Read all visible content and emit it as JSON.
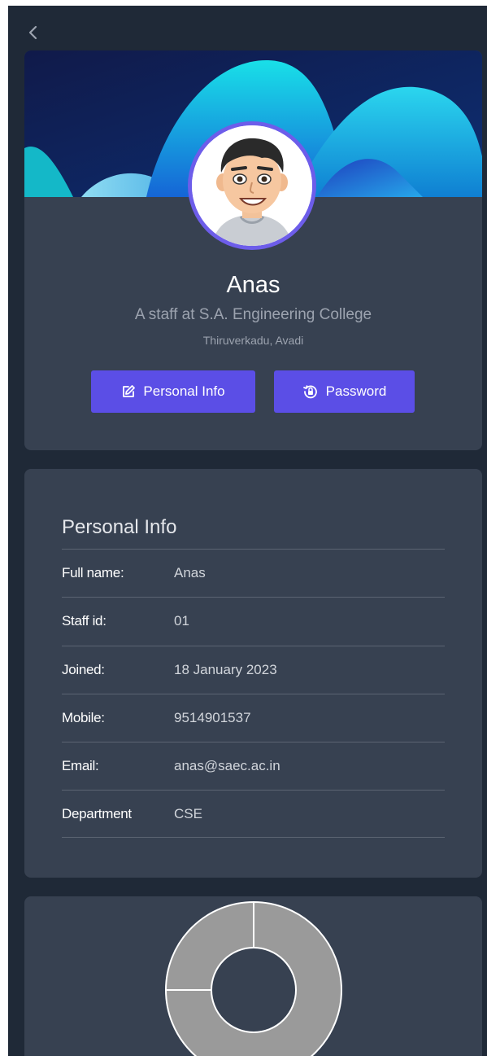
{
  "icons": {
    "back": "chevron-left-icon",
    "edit": "edit-icon",
    "password": "lock-reset-icon"
  },
  "colors": {
    "background": "#1f2937",
    "card": "#374151",
    "accent": "#5b4ee6",
    "avatar_ring": "#6d5dea"
  },
  "profile": {
    "name": "Anas",
    "role": "A staff at S.A. Engineering College",
    "location": "Thiruverkadu, Avadi",
    "buttons": {
      "personal_info": "Personal Info",
      "password": "Password"
    }
  },
  "personal_info": {
    "title": "Personal Info",
    "rows": [
      {
        "label": "Full name:",
        "value": "Anas"
      },
      {
        "label": "Staff id:",
        "value": "01"
      },
      {
        "label": "Joined:",
        "value": "18 January 2023"
      },
      {
        "label": "Mobile:",
        "value": "9514901537"
      },
      {
        "label": "Email:",
        "value": "anas@saec.ac.in"
      },
      {
        "label": "Department",
        "value": "CSE"
      }
    ]
  },
  "chart_data": {
    "type": "pie",
    "categories": [
      "",
      ""
    ],
    "values": [
      75,
      25
    ],
    "colors": [
      "#9a9a9a",
      "#9a9a9a"
    ],
    "title": "",
    "donut": true
  }
}
